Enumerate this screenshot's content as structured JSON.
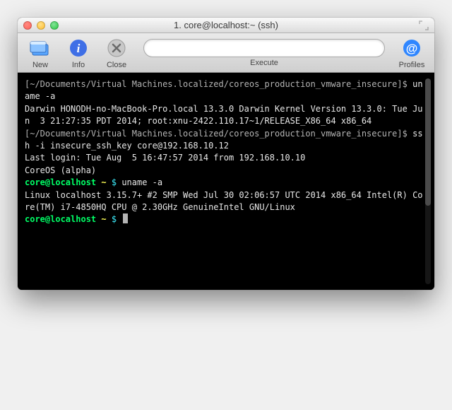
{
  "window": {
    "title": "1. core@localhost:~ (ssh)"
  },
  "toolbar": {
    "new": "New",
    "info": "Info",
    "close": "Close",
    "execute": "Execute",
    "profiles": "Profiles"
  },
  "colors": {
    "prompt_user": "#00ff66",
    "prompt_tilde": "#ffff55",
    "prompt_dollar": "#3df0ff"
  },
  "session": {
    "host_prompt_path": "[~/Documents/Virtual Machines.localized/coreos_production_vmware_insecure]$",
    "cmd1": "uname -a",
    "out1": "Darwin HONODH-no-MacBook-Pro.local 13.3.0 Darwin Kernel Version 13.3.0: Tue Jun  3 21:27:35 PDT 2014; root:xnu-2422.110.17~1/RELEASE_X86_64 x86_64",
    "cmd2": "ssh -i insecure_ssh_key core@192.168.10.12",
    "lastlogin": "Last login: Tue Aug  5 16:47:57 2014 from 192.168.10.10",
    "banner": "CoreOS (alpha)",
    "remote_prompt_user": "core@localhost",
    "remote_prompt_path": "~",
    "remote_prompt_dollar": "$",
    "cmd3": "uname -a",
    "out3": "Linux localhost 3.15.7+ #2 SMP Wed Jul 30 02:06:57 UTC 2014 x86_64 Intel(R) Core(TM) i7-4850HQ CPU @ 2.30GHz GenuineIntel GNU/Linux"
  }
}
